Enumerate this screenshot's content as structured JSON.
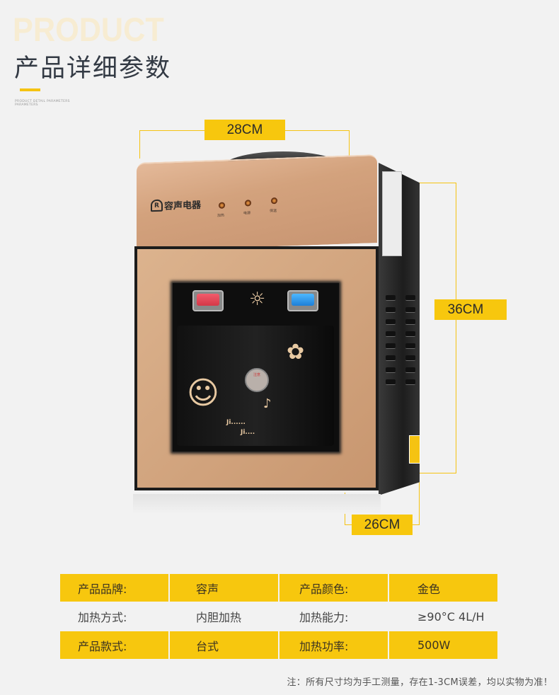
{
  "header": {
    "background_word": "PRODUCT",
    "title": "产品详细参数",
    "subtitle": "PRODUCT DETAIL PARAMETERS PARAMETERS"
  },
  "dimensions": {
    "width": "28CM",
    "height": "36CM",
    "depth": "26CM"
  },
  "product": {
    "brand": "容声电器",
    "brand_logo": "R",
    "indicators": [
      "加热",
      "电源",
      "保温"
    ],
    "sticker": "注意",
    "decals": [
      "Ji......",
      "Ji...."
    ]
  },
  "specs": [
    {
      "label1": "产品品牌:",
      "value1": "容声",
      "label2": "产品颜色:",
      "value2": "金色"
    },
    {
      "label1": "加热方式:",
      "value1": "内胆加热",
      "label2": "加热能力:",
      "value2": "≥90°C 4L/H"
    },
    {
      "label1": "产品款式:",
      "value1": "台式",
      "label2": "加热功率:",
      "value2": "500W"
    }
  ],
  "note": "注：所有尺寸均为手工测量，存在1-3CM误差，均以实物为准！",
  "colors": {
    "accent": "#f7c70e",
    "background": "#f2f2f2",
    "product_gold": "#d2a57f"
  }
}
